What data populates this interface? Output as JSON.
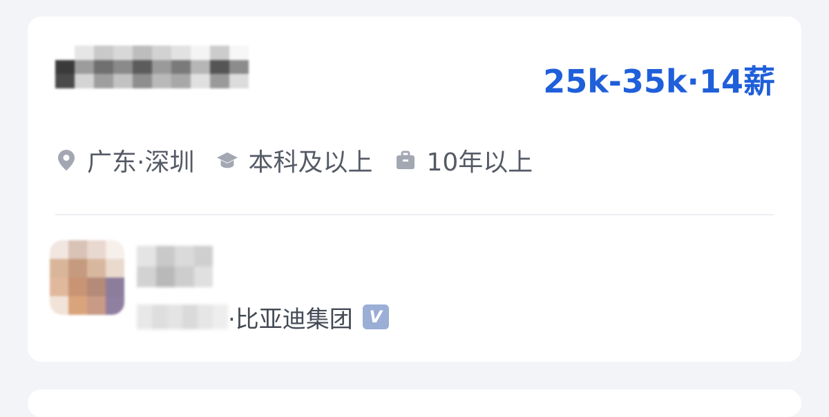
{
  "job": {
    "salary": "25k-35k·14薪",
    "location": "广东·深圳",
    "education": "本科及以上",
    "experience": "10年以上"
  },
  "recruiter": {
    "company": "·比亚迪集团",
    "verified_badge": "V"
  },
  "colors": {
    "salary": "#1f5fd9",
    "meta_icon": "#a3a7b2",
    "meta_text": "#555a66",
    "verified_badge": "#9aaed6",
    "card": "#ffffff",
    "page_background": "#f3f4f8"
  },
  "icons": {
    "location": "map-pin-icon",
    "education": "graduation-cap-icon",
    "experience": "briefcase-icon"
  }
}
